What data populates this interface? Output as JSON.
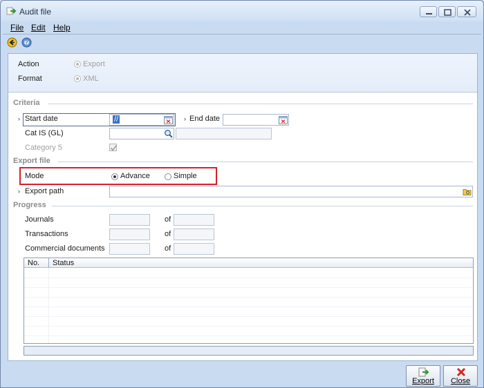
{
  "window": {
    "title": "Audit file"
  },
  "menu": {
    "file": "File",
    "edit": "Edit",
    "help": "Help"
  },
  "top_options": {
    "action_label": "Action",
    "action_value": "Export",
    "format_label": "Format",
    "format_value": "XML"
  },
  "criteria": {
    "section_title": "Criteria",
    "start_date_label": "Start date",
    "start_date_value": "//",
    "end_date_label": "End date",
    "end_date_value": "",
    "cat_is_label": "Cat IS (GL)",
    "cat_is_value": "",
    "category5_label": "Category 5"
  },
  "export_file": {
    "section_title": "Export file",
    "mode_label": "Mode",
    "mode_options": [
      "Advance",
      "Simple"
    ],
    "mode_selected": "Advance",
    "export_path_label": "Export path",
    "export_path_value": ""
  },
  "progress": {
    "section_title": "Progress",
    "rows": [
      {
        "label": "Journals",
        "of": "of"
      },
      {
        "label": "Transactions",
        "of": "of"
      },
      {
        "label": "Commercial documents",
        "of": "of"
      }
    ],
    "columns": [
      "No.",
      "Status"
    ]
  },
  "buttons": {
    "export_label": "Export",
    "close_label": "Close"
  },
  "colors": {
    "highlight": "#d81e2b",
    "window_bg": "#c9dbf1",
    "section_title": "#8c8c8c"
  }
}
